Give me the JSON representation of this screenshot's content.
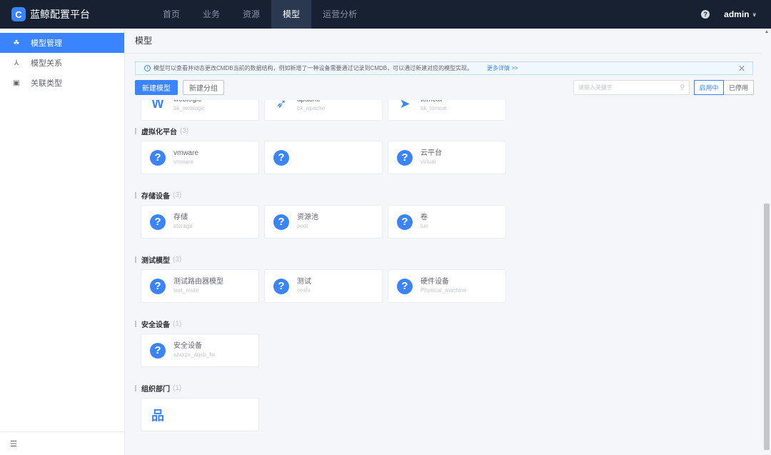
{
  "app": {
    "title": "蓝鲸配置平台",
    "logo_letter": "C"
  },
  "nav": {
    "items": [
      {
        "label": "首页",
        "active": false
      },
      {
        "label": "业务",
        "active": false
      },
      {
        "label": "资源",
        "active": false
      },
      {
        "label": "模型",
        "active": true
      },
      {
        "label": "运营分析",
        "active": false
      }
    ]
  },
  "header": {
    "help_icon": "?",
    "user": "admin",
    "chevron": "∨"
  },
  "sidebar": {
    "items": [
      {
        "label": "模型管理",
        "icon": "☘",
        "active": true
      },
      {
        "label": "模型关系",
        "icon": "⅄",
        "active": false
      },
      {
        "label": "关联类型",
        "icon": "▣",
        "active": false
      }
    ],
    "collapse_icon": "☰"
  },
  "page": {
    "title": "模型"
  },
  "alert": {
    "icon": "i",
    "text": "模型可以查看并动态更改CMDB当前的数据结构，例如新增了一种设备需要通过记录到CMDB，可以通过新建对应的模型实现。",
    "more": "更多详情 >>",
    "close": "✕"
  },
  "toolbar": {
    "new_model": "新建模型",
    "new_group": "新建分组",
    "search_placeholder": "请输入关键字",
    "search_icon": "⚲",
    "enabled": "启用中",
    "disabled": "已停用"
  },
  "groups": [
    {
      "title": "",
      "count": "",
      "models": [
        {
          "name": "weblogic",
          "id": "bk_weblogic",
          "icon": "W"
        },
        {
          "name": "apache",
          "id": "bk_apache",
          "icon": "➶"
        },
        {
          "name": "tomcat",
          "id": "bk_tomcat",
          "icon": "➤"
        }
      ]
    },
    {
      "title": "虚拟化平台",
      "count": "(3)",
      "models": [
        {
          "name": "vmware",
          "id": "vmware",
          "icon": "?"
        },
        {
          "name": "",
          "id": "",
          "icon": "?"
        },
        {
          "name": "云平台",
          "id": "virtual",
          "icon": "?"
        }
      ]
    },
    {
      "title": "存储设备",
      "count": "(3)",
      "models": [
        {
          "name": "存储",
          "id": "storage",
          "icon": "?"
        },
        {
          "name": "资源池",
          "id": "pool",
          "icon": "?"
        },
        {
          "name": "卷",
          "id": "lun",
          "icon": "?"
        }
      ]
    },
    {
      "title": "测试模型",
      "count": "(3)",
      "models": [
        {
          "name": "测试路由器模型",
          "id": "test_route",
          "icon": "?"
        },
        {
          "name": "测试",
          "id": "ceshi",
          "icon": "?"
        },
        {
          "name": "硬件设备",
          "id": "Physical_machine",
          "icon": "?"
        }
      ]
    },
    {
      "title": "安全设备",
      "count": "(1)",
      "models": [
        {
          "name": "安全设备",
          "id": "szxxzx_aqsb_fw",
          "icon": "?"
        }
      ]
    },
    {
      "title": "组织部门",
      "count": "(1)",
      "models": [
        {
          "name": "",
          "id": "",
          "icon": "品"
        }
      ]
    }
  ]
}
